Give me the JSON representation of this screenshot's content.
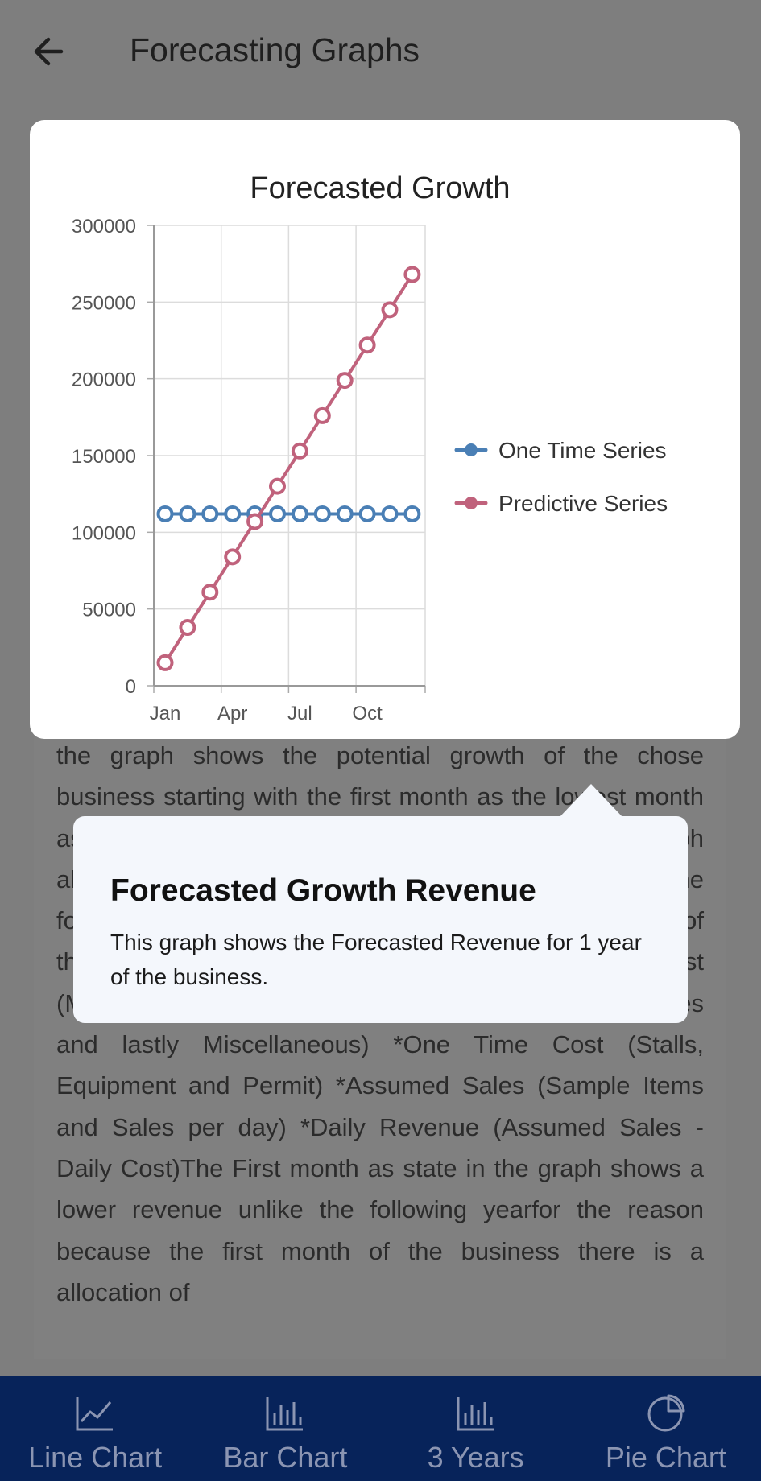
{
  "header": {
    "title": "Forecasting Graphs",
    "back_icon": "arrow-left-icon"
  },
  "chart_data": {
    "type": "line",
    "title": "Forecasted Growth",
    "xlabel": "",
    "ylabel": "",
    "ylim": [
      0,
      300000
    ],
    "y_ticks": [
      "0",
      "50000",
      "100000",
      "150000",
      "200000",
      "250000",
      "300000"
    ],
    "x_ticks": [
      "Jan",
      "Apr",
      "Jul",
      "Oct"
    ],
    "x": [
      1,
      2,
      3,
      4,
      5,
      6,
      7,
      8,
      9,
      10,
      11,
      12
    ],
    "grid": true,
    "legend_position": "right",
    "series": [
      {
        "name": "One Time Series",
        "color": "#4a7fb5",
        "values": [
          112000,
          112000,
          112000,
          112000,
          112000,
          112000,
          112000,
          112000,
          112000,
          112000,
          112000,
          112000
        ]
      },
      {
        "name": "Predictive Series",
        "color": "#c0627c",
        "values": [
          15000,
          38000,
          61000,
          84000,
          107000,
          130000,
          153000,
          176000,
          199000,
          222000,
          245000,
          268000
        ]
      }
    ]
  },
  "content": {
    "paragraph": "the graph shows the potential growth of the chose business starting with the first month as the lowest month as well as the monthly revenue of the business. The graph also shows the projection of the business through the following year which includes the total monthly revenue of the businessParameters includes the following *Daily Cost (Man power, Supplies, Marketing Cost, Lease and Utilities and lastly Miscellaneous) *One Time Cost (Stalls, Equipment and Permit) *Assumed Sales (Sample Items and Sales per day) *Daily Revenue (Assumed Sales - Daily Cost)The First month as state in the graph shows a lower revenue unlike the following yearfor the reason because the first month of the business there is a allocation of"
  },
  "popover": {
    "title": "Forecasted Growth Revenue",
    "description": "This graph shows the Forecasted Revenue for 1 year of the business."
  },
  "bottom_nav": {
    "items": [
      {
        "label": "Line Chart",
        "icon": "line-chart-icon"
      },
      {
        "label": "Bar Chart",
        "icon": "bar-chart-icon"
      },
      {
        "label": "3 Years",
        "icon": "bar-chart-icon"
      },
      {
        "label": "Pie Chart",
        "icon": "pie-chart-icon"
      }
    ]
  }
}
